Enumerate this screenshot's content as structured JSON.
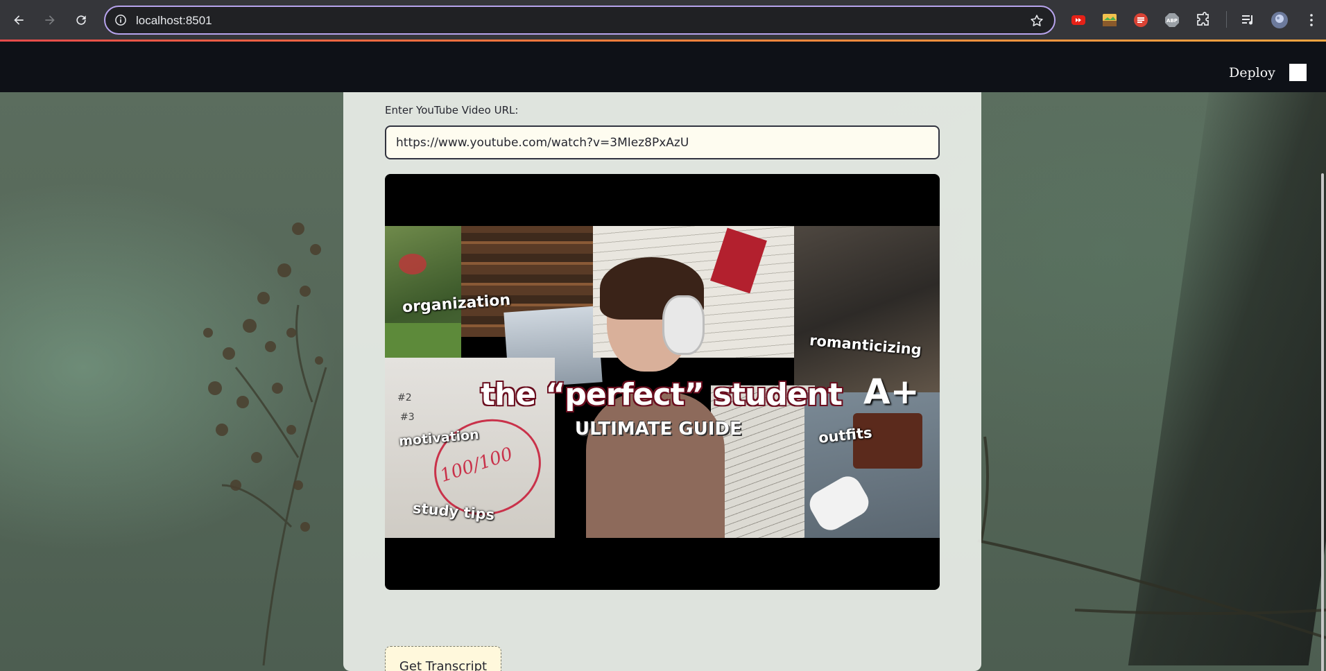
{
  "browser": {
    "url": "localhost:8501",
    "icons": {
      "back": "back-arrow-icon",
      "forward": "forward-arrow-icon",
      "reload": "reload-icon",
      "info": "info-icon",
      "bookmark": "star-icon",
      "extensions": [
        "youtube-extension-icon",
        "image-extension-icon",
        "scribe-extension-icon",
        "adblock-extension-icon",
        "puzzle-extensions-icon"
      ],
      "media": "media-queue-icon",
      "profile": "profile-avatar-icon",
      "menu": "kebab-menu-icon"
    },
    "extension_labels": {
      "adblock": "ABP"
    }
  },
  "app": {
    "header": {
      "deploy_label": "Deploy"
    },
    "form": {
      "url_label": "Enter YouTube Video URL:",
      "url_value": "https://www.youtube.com/watch?v=3MIez8PxAzU",
      "submit_label": "Get Transcript"
    },
    "video": {
      "thumbnail_texts": {
        "organization": "organization",
        "romanticizing": "romanticizing",
        "title": "the “perfect” student",
        "subtitle": "ULTIMATE GUIDE",
        "grade": "A+",
        "motivation": "motivation",
        "outfits": "outfits",
        "study_tips": "study tips",
        "list_2": "#2",
        "list_3": "#3",
        "score": "100/100"
      }
    }
  },
  "colors": {
    "header_bg": "#0e1117",
    "panel_bg": "#eaefe9",
    "input_bg": "#fefcf0",
    "button_bg": "#fff8dc",
    "omnibox_border": "#b8a4ee"
  }
}
